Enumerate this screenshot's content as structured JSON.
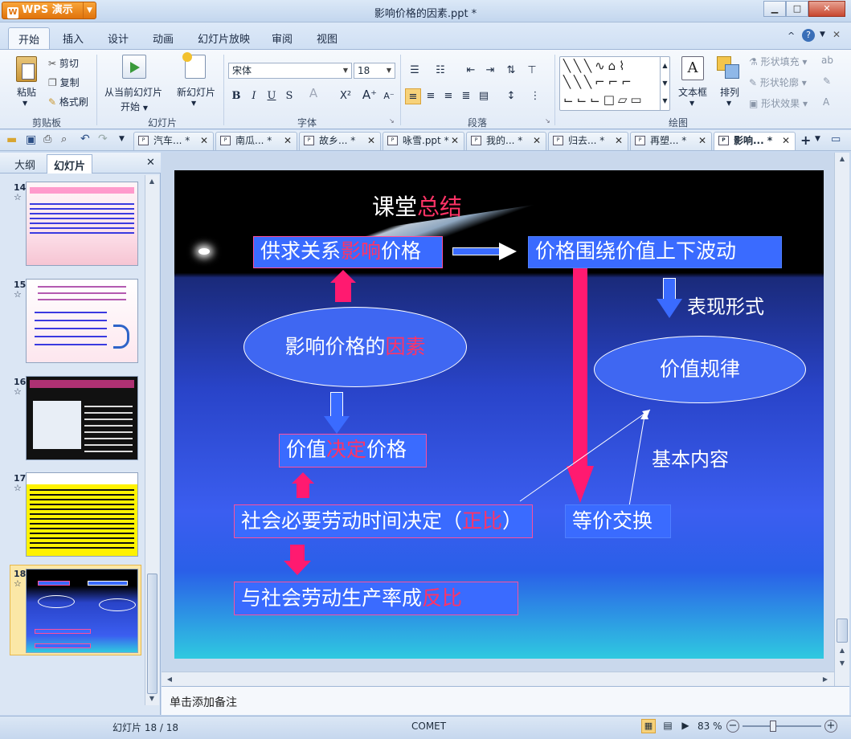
{
  "app": {
    "button_label": "WPS 演示",
    "window_title": "影响价格的因素.ppt *"
  },
  "window_controls": {
    "minimize": "▁",
    "restore": "□",
    "close": "✕"
  },
  "menu": {
    "items": [
      "开始",
      "插入",
      "设计",
      "动画",
      "幻灯片放映",
      "审阅",
      "视图"
    ],
    "right_icons": [
      "^",
      "?"
    ]
  },
  "ribbon": {
    "clipboard": {
      "paste": "粘贴",
      "cut": "剪切",
      "copy": "复制",
      "format_painter": "格式刷",
      "group_label": "剪贴板"
    },
    "slides": {
      "from_current": "从当前幻灯片",
      "start": "开始",
      "new_slide": "新幻灯片",
      "group_label": "幻灯片"
    },
    "font": {
      "font_name": "宋体",
      "font_size": "18",
      "bold": "B",
      "italic": "I",
      "underline": "U",
      "strike": "S",
      "group_label": "字体"
    },
    "paragraph": {
      "group_label": "段落"
    },
    "drawing": {
      "textbox": "文本框",
      "arrange": "排列",
      "shape_fill": "形状填充",
      "shape_outline": "形状轮廓",
      "shape_effect": "形状效果",
      "group_label": "绘图"
    }
  },
  "doc_tabs": [
    {
      "label": "汽车... *",
      "active": false
    },
    {
      "label": "南瓜... *",
      "active": false
    },
    {
      "label": "故乡... *",
      "active": false
    },
    {
      "label": "咏雪.ppt *",
      "active": false
    },
    {
      "label": "我的... *",
      "active": false
    },
    {
      "label": "归去... *",
      "active": false
    },
    {
      "label": "再塑... *",
      "active": false
    },
    {
      "label": "影响... *",
      "active": true
    }
  ],
  "left_pane": {
    "tab_outline": "大纲",
    "tab_slides": "幻灯片",
    "close": "✕",
    "thumbnails": [
      {
        "num": "14",
        "star": "☆"
      },
      {
        "num": "15",
        "star": "☆"
      },
      {
        "num": "16",
        "star": "☆"
      },
      {
        "num": "17",
        "star": "☆"
      },
      {
        "num": "18",
        "star": "☆"
      }
    ]
  },
  "slide": {
    "title_a": "课堂",
    "title_b": "总结",
    "box1_a": "供求关系",
    "box1_b": "影响",
    "box1_c": "价格",
    "box2": "价格围绕价值上下波动",
    "label_form": "表现形式",
    "ellipse1_a": "影响价格的",
    "ellipse1_b": "因素",
    "ellipse2": "价值规律",
    "box3_a": "价值",
    "box3_b": "决定",
    "box3_c": "价格",
    "label_content": "基本内容",
    "box4_a": "社会必要劳动时间决定（",
    "box4_b": "正比",
    "box4_c": "）",
    "box5": "等价交换",
    "box6_a": "与社会劳动生产率成",
    "box6_b": "反比"
  },
  "notes_placeholder": "单击添加备注",
  "status": {
    "slide_count": "幻灯片 18 / 18",
    "theme": "COMET",
    "zoom": "83 %"
  }
}
